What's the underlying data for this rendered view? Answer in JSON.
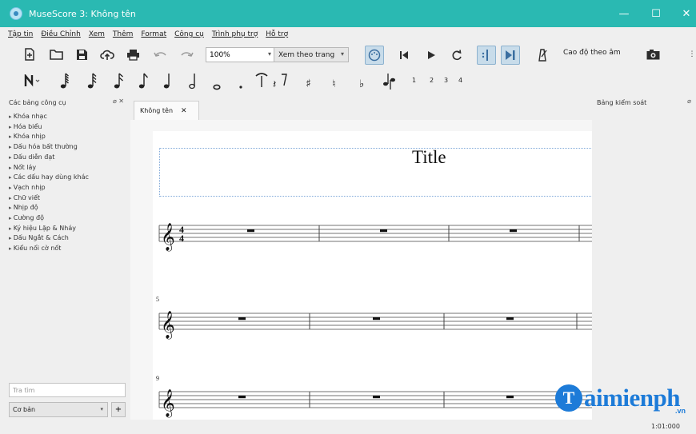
{
  "window": {
    "title": "MuseScore 3: Không tên",
    "min_glyph": "—",
    "max_glyph": "☐",
    "close_glyph": "✕"
  },
  "menu": [
    "Tập tin",
    "Điều Chỉnh",
    "Xem",
    "Thêm",
    "Format",
    "Công cụ",
    "Trình phụ trợ",
    "Hỗ trợ"
  ],
  "toolbar": {
    "zoom_value": "100%",
    "view_mode": "Xem theo trang",
    "concert_pitch": "Cao độ theo âm"
  },
  "note_input": {
    "voices": [
      "1",
      "2",
      "3",
      "4"
    ]
  },
  "palette": {
    "header": "Các bảng công cụ",
    "items": [
      "Khóa nhạc",
      "Hóa biểu",
      "Khóa nhịp",
      "Dấu hóa bất thường",
      "Dấu diễn đạt",
      "Nốt láy",
      "Các dấu hay dùng khác",
      "Vạch nhịp",
      "Chữ viết",
      "Nhịp độ",
      "Cường độ",
      "Ký hiệu Lặp & Nháy",
      "Dấu Ngắt & Cách",
      "Kiểu nối cờ nốt"
    ],
    "search_placeholder": "Tra tìm",
    "workspace": "Cơ bản"
  },
  "inspector": {
    "header": "Bảng kiểm soát"
  },
  "document": {
    "tab_label": "Không tên",
    "score_title": "Title",
    "time_signature_top": "4",
    "time_signature_bottom": "4",
    "measure_numbers": [
      "5",
      "9"
    ]
  },
  "status": {
    "time": "1:01:000"
  },
  "watermark": {
    "logo_letter": "T",
    "text": "aimienph",
    "suffix": ".vn"
  },
  "colors": {
    "titlebar": "#2ab9b2",
    "accent_blue": "#3a8bc1"
  }
}
